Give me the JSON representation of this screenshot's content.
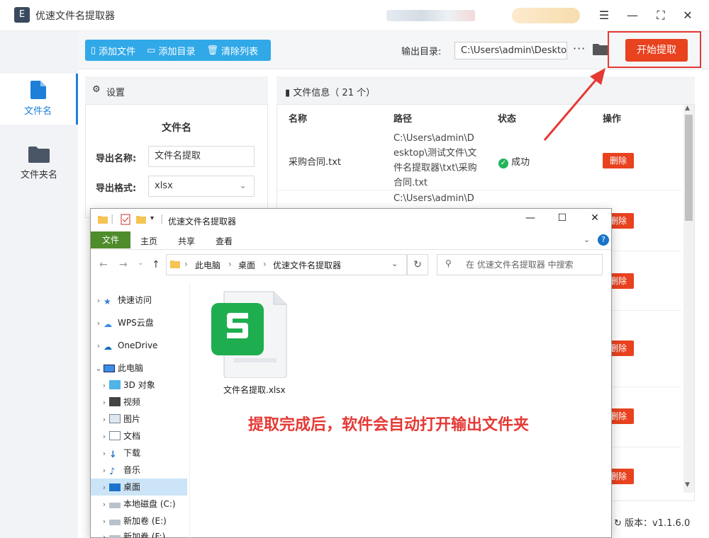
{
  "app": {
    "title": "优速文件名提取器",
    "logo_glyph": "E"
  },
  "window_controls": {
    "menu": "☰",
    "minimize": "—",
    "maximize": "⛶",
    "close": "✕"
  },
  "sidebar": {
    "items": [
      {
        "label": "文件名",
        "icon": "file-icon",
        "active": true
      },
      {
        "label": "文件夹名",
        "icon": "folder-icon",
        "active": false
      }
    ]
  },
  "toolbar": {
    "add_file": "添加文件",
    "add_dir": "添加目录",
    "clear_list": "清除列表",
    "output_label": "输出目录:",
    "output_path": "C:\\Users\\admin\\Desktop",
    "more": "···",
    "start": "开始提取",
    "accent": "#e8421f",
    "blue": "#31a9e8"
  },
  "settings": {
    "header": "设置",
    "section_title": "文件名",
    "export_name_label": "导出名称:",
    "export_name_value": "文件名提取",
    "export_format_label": "导出格式:",
    "export_format_value": "xlsx"
  },
  "file_info": {
    "header": "文件信息（ 21 个）",
    "columns": {
      "name": "名称",
      "path": "路径",
      "status": "状态",
      "action": "操作"
    },
    "rows": [
      {
        "name": "采购合同.txt",
        "path": "C:\\Users\\admin\\Desktop\\测试文件\\文件名提取器\\txt\\采购合同.txt",
        "status": "成功",
        "action": "删除"
      }
    ],
    "partial_row_path": "C:\\Users\\admin\\D",
    "delete_label": "删除"
  },
  "version": "版本：v1.1.6.0",
  "explorer": {
    "title": "优速文件名提取器",
    "ribbon": {
      "file": "文件",
      "home": "主页",
      "share": "共享",
      "view": "查看"
    },
    "breadcrumb": [
      "此电脑",
      "桌面",
      "优速文件名提取器"
    ],
    "search_placeholder": "在 优速文件名提取器 中搜索",
    "tree": [
      {
        "label": "快速访问",
        "icon": "star-icon",
        "level": 0
      },
      {
        "label": "WPS云盘",
        "icon": "cloud-icon",
        "level": 0
      },
      {
        "label": "OneDrive",
        "icon": "onedrive-icon",
        "level": 0
      },
      {
        "label": "此电脑",
        "icon": "computer-icon",
        "level": 0,
        "expanded": true
      },
      {
        "label": "3D 对象",
        "icon": "cube-icon",
        "level": 1
      },
      {
        "label": "视频",
        "icon": "video-icon",
        "level": 1
      },
      {
        "label": "图片",
        "icon": "picture-icon",
        "level": 1
      },
      {
        "label": "文档",
        "icon": "document-icon",
        "level": 1
      },
      {
        "label": "下载",
        "icon": "download-icon",
        "level": 1
      },
      {
        "label": "音乐",
        "icon": "music-icon",
        "level": 1
      },
      {
        "label": "桌面",
        "icon": "desktop-icon",
        "level": 1,
        "selected": true
      },
      {
        "label": "本地磁盘 (C:)",
        "icon": "drive-icon",
        "level": 1
      },
      {
        "label": "新加卷 (E:)",
        "icon": "drive-icon",
        "level": 1
      },
      {
        "label": "新加卷 (F:)",
        "icon": "drive-icon",
        "level": 1
      }
    ],
    "file": {
      "name": "文件名提取.xlsx",
      "icon": "wps-spreadsheet-icon",
      "icon_color": "#1fae4f"
    }
  },
  "annotation": {
    "message": "提取完成后，软件会自动打开输出文件夹",
    "color": "#e53935"
  }
}
